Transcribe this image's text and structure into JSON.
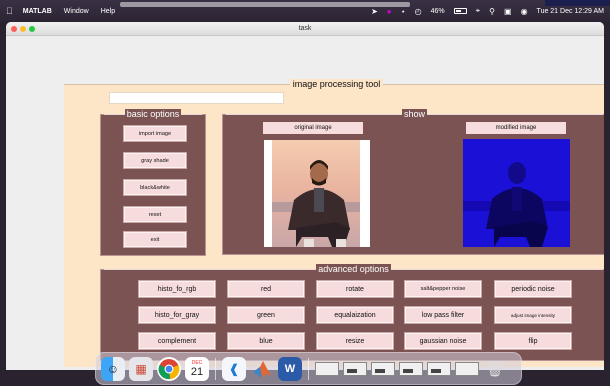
{
  "menubar": {
    "apple": "",
    "app": "MATLAB",
    "items": [
      "Window",
      "Help"
    ],
    "battery": "46%",
    "datetime": "Tue 21 Dec  12:29 AM"
  },
  "window": {
    "title": "task"
  },
  "panel": {
    "title": "image processing tool",
    "edit_value": ""
  },
  "basic": {
    "title": "basic options",
    "buttons": [
      "import image",
      "gray shade",
      "black&white",
      "reset",
      "exit"
    ]
  },
  "show": {
    "title": "show",
    "original_label": "original image",
    "modified_label": "modified image"
  },
  "advanced": {
    "title": "advanced options",
    "buttons": [
      "histo_fo_rgb",
      "red",
      "rotate",
      "salt&pepper noise",
      "periodic noise",
      "histo_for_gray",
      "green",
      "equalaization",
      "low pass filter",
      "adjust image intensity",
      "complement",
      "blue",
      "resize",
      "gaussian noise",
      "flip"
    ]
  },
  "dock": {
    "calendar_month": "DEC",
    "calendar_day": "21"
  },
  "colors": {
    "panel_bg": "#fde5c7",
    "group_bg": "#7c5353",
    "button_bg": "#f6dcdc",
    "modified_tint": "#1a10d6"
  }
}
